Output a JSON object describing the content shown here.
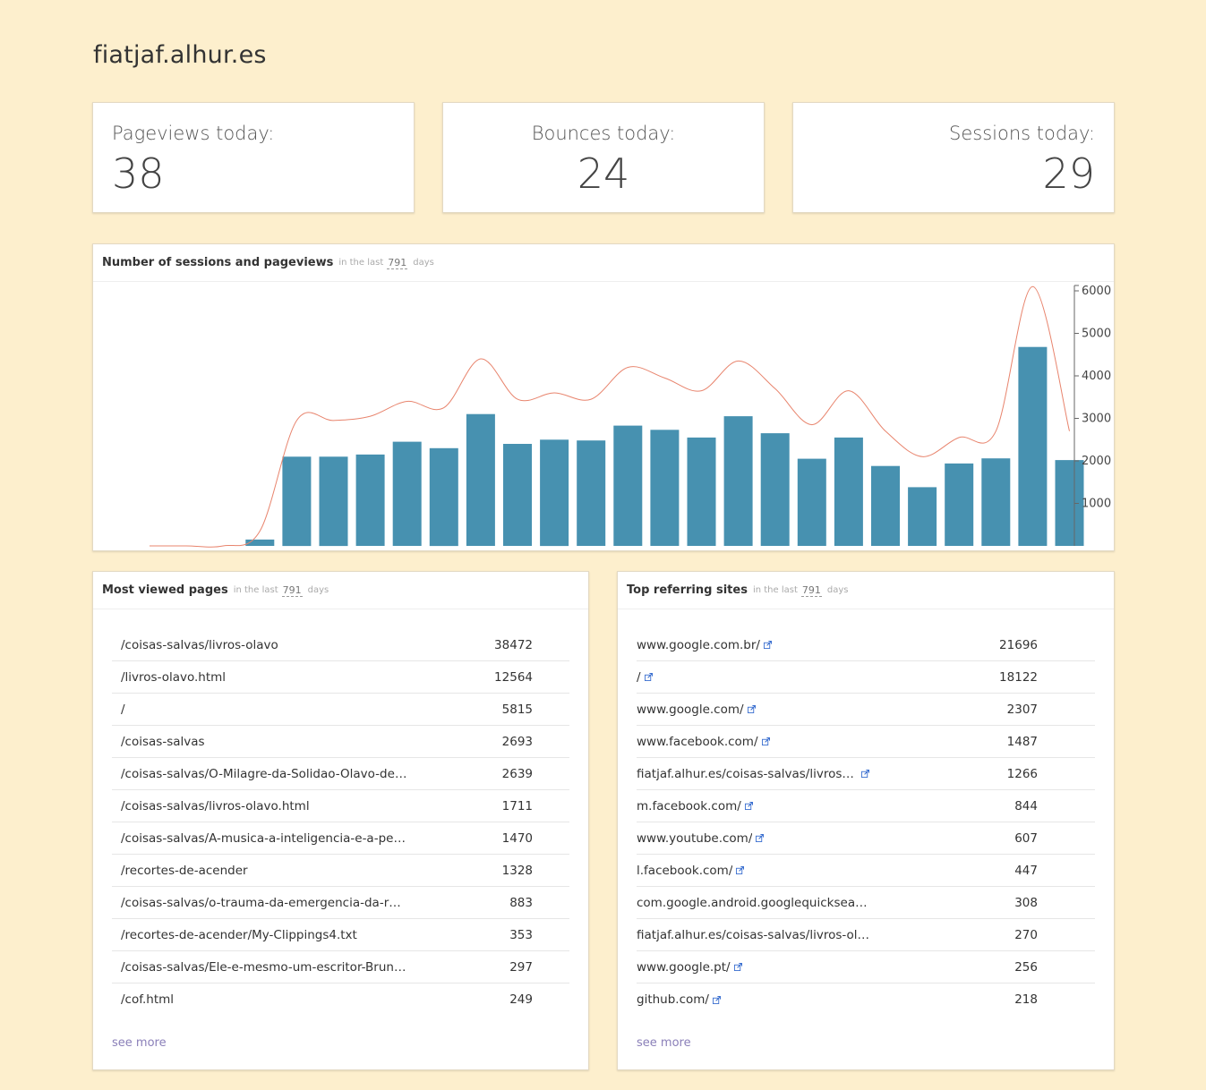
{
  "site": {
    "title": "fiatjaf.alhur.es"
  },
  "stats": {
    "pageviews": {
      "label": "Pageviews today:",
      "value": "38"
    },
    "bounces": {
      "label": "Bounces today:",
      "value": "24"
    },
    "sessions": {
      "label": "Sessions today:",
      "value": "29"
    }
  },
  "period": {
    "prefix": "in the last",
    "days": "791",
    "suffix": "days"
  },
  "chart_panel": {
    "title": "Number of sessions and pageviews"
  },
  "colors": {
    "bar": "#4791b0",
    "line": "#e8846d",
    "background": "#fdefcd"
  },
  "chart_data": {
    "type": "bar",
    "series": [
      {
        "values": [
          0,
          0,
          0,
          150,
          2100,
          2100,
          2150,
          2450,
          2300,
          3100,
          2400,
          2500,
          2480,
          2830,
          2730,
          2550,
          3050,
          2650,
          2050,
          2550,
          1880,
          1380,
          1940,
          2060,
          4680,
          2020
        ]
      },
      {
        "values": [
          0,
          0,
          0,
          350,
          2950,
          2950,
          3050,
          3400,
          3250,
          4400,
          3450,
          3600,
          3450,
          4200,
          3950,
          3650,
          4350,
          3700,
          2850,
          3650,
          2700,
          2100,
          2550,
          2700,
          6100,
          2700
        ]
      }
    ],
    "ylim": [
      0,
      6000
    ],
    "yticks": [
      "1000",
      "2000",
      "3000",
      "4000",
      "5000",
      "6000"
    ],
    "ytick_values": [
      1000,
      2000,
      3000,
      4000,
      5000,
      6000
    ],
    "axis": "right",
    "grid": false
  },
  "most_viewed": {
    "title": "Most viewed pages",
    "rows": [
      {
        "path": "/coisas-salvas/livros-olavo",
        "count": "38472"
      },
      {
        "path": "/livros-olavo.html",
        "count": "12564"
      },
      {
        "path": "/",
        "count": "5815"
      },
      {
        "path": "/coisas-salvas",
        "count": "2693"
      },
      {
        "path": "/coisas-salvas/O-Milagre-da-Solidao-Olavo-de-Ca…",
        "count": "2639"
      },
      {
        "path": "/coisas-salvas/livros-olavo.html",
        "count": "1711"
      },
      {
        "path": "/coisas-salvas/A-musica-a-inteligencia-e-a-perso…",
        "count": "1470"
      },
      {
        "path": "/recortes-de-acender",
        "count": "1328"
      },
      {
        "path": "/coisas-salvas/o-trauma-da-emergencia-da-razao",
        "count": "883"
      },
      {
        "path": "/recortes-de-acender/My-Clippings4.txt",
        "count": "353"
      },
      {
        "path": "/coisas-salvas/Ele-e-mesmo-um-escritor-Bruno-T…",
        "count": "297"
      },
      {
        "path": "/cof.html",
        "count": "249"
      }
    ],
    "see_more": "see more"
  },
  "top_referrers": {
    "title": "Top referring sites",
    "rows": [
      {
        "site": "www.google.com.br/",
        "count": "21696",
        "link": true
      },
      {
        "site": "/",
        "count": "18122",
        "link": true
      },
      {
        "site": "www.google.com/",
        "count": "2307",
        "link": true
      },
      {
        "site": "www.facebook.com/",
        "count": "1487",
        "link": true
      },
      {
        "site": "fiatjaf.alhur.es/coisas-salvas/livros-olavo",
        "count": "1266",
        "link": true
      },
      {
        "site": "m.facebook.com/",
        "count": "844",
        "link": true
      },
      {
        "site": "www.youtube.com/",
        "count": "607",
        "link": true
      },
      {
        "site": "l.facebook.com/",
        "count": "447",
        "link": true
      },
      {
        "site": "com.google.android.googlequicksearchbo…",
        "count": "308",
        "link": false
      },
      {
        "site": "fiatjaf.alhur.es/coisas-salvas/livros-olavo.ht…",
        "count": "270",
        "link": false
      },
      {
        "site": "www.google.pt/",
        "count": "256",
        "link": true
      },
      {
        "site": "github.com/",
        "count": "218",
        "link": true
      }
    ],
    "see_more": "see more"
  }
}
